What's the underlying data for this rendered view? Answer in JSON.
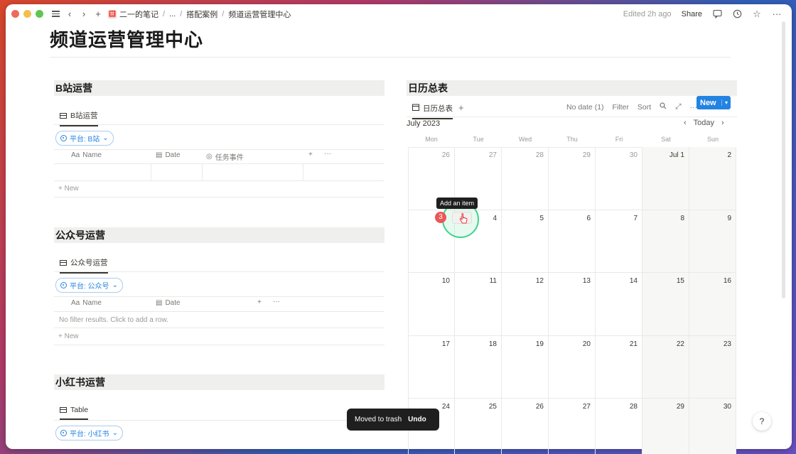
{
  "titlebar": {
    "breadcrumbs": [
      "二一的笔记",
      "...",
      "搭配案例",
      "频道运营管理中心"
    ],
    "emoji": "🈲",
    "edited": "Edited 2h ago",
    "share": "Share"
  },
  "page": {
    "title": "频道运营管理中心"
  },
  "bili": {
    "heading": "B站运营",
    "tab": "B站运营",
    "filter": "平台: B站",
    "cols": [
      "Name",
      "Date",
      "任务事件"
    ],
    "new": "New"
  },
  "gzh": {
    "heading": "公众号运营",
    "tab": "公众号运营",
    "filter": "平台: 公众号",
    "cols": [
      "Name",
      "Date"
    ],
    "empty": "No filter results. Click to add a row.",
    "new": "New"
  },
  "xhs": {
    "heading": "小红书运营",
    "tab": "Table",
    "filter": "平台: 小红书"
  },
  "calendar": {
    "heading": "日历总表",
    "tab": "日历总表",
    "no_date": "No date (1)",
    "filter": "Filter",
    "sort": "Sort",
    "new": "New",
    "month": "July 2023",
    "today": "Today",
    "weekdays": [
      "Mon",
      "Tue",
      "Wed",
      "Thu",
      "Fri",
      "Sat",
      "Sun"
    ],
    "tooltip": "Add an item",
    "add_symbol": "+",
    "today_num": "3",
    "weeks": [
      [
        "26",
        "27",
        "28",
        "29",
        "30",
        "Jul 1",
        "2"
      ],
      [
        "",
        "",
        "4",
        "5",
        "6",
        "7",
        "8",
        "9"
      ],
      [
        "10",
        "11",
        "12",
        "13",
        "14",
        "15",
        "16"
      ],
      [
        "17",
        "18",
        "19",
        "20",
        "21",
        "22",
        "23"
      ],
      [
        "24",
        "25",
        "26",
        "27",
        "28",
        "29",
        "30"
      ]
    ]
  },
  "toast": {
    "message": "Moved to trash",
    "action": "Undo"
  },
  "help": "?"
}
